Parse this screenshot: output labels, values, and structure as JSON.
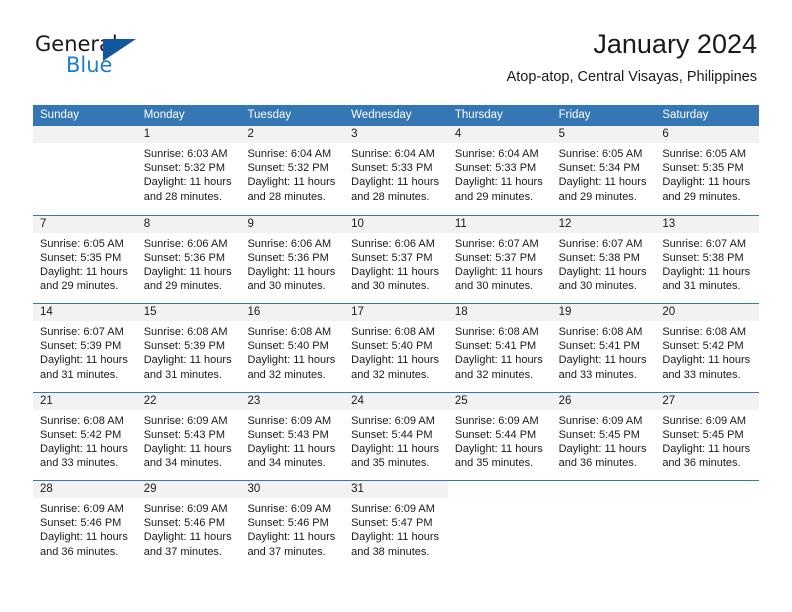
{
  "brand": {
    "word_one": "General",
    "word_two": "Blue",
    "accent_color": "#1f7fc4",
    "triangle_color": "#1257a0"
  },
  "header": {
    "title": "January 2024",
    "location": "Atop-atop, Central Visayas, Philippines"
  },
  "theme": {
    "header_bar_color": "#3576b5",
    "day_band_color": "#f2f2f2",
    "text_color": "#1a1a1a"
  },
  "weekday_headers": [
    "Sunday",
    "Monday",
    "Tuesday",
    "Wednesday",
    "Thursday",
    "Friday",
    "Saturday"
  ],
  "labels": {
    "sunrise_prefix": "Sunrise:",
    "sunset_prefix": "Sunset:",
    "daylight_prefix": "Daylight:"
  },
  "weeks": [
    {
      "days": [
        {
          "num": "",
          "state": "blank",
          "l1": "",
          "l2": "",
          "l3": "",
          "l4": ""
        },
        {
          "num": "1",
          "state": "day",
          "l1": "Sunrise: 6:03 AM",
          "l2": "Sunset: 5:32 PM",
          "l3": "Daylight: 11 hours",
          "l4": "and 28 minutes."
        },
        {
          "num": "2",
          "state": "day",
          "l1": "Sunrise: 6:04 AM",
          "l2": "Sunset: 5:32 PM",
          "l3": "Daylight: 11 hours",
          "l4": "and 28 minutes."
        },
        {
          "num": "3",
          "state": "day",
          "l1": "Sunrise: 6:04 AM",
          "l2": "Sunset: 5:33 PM",
          "l3": "Daylight: 11 hours",
          "l4": "and 28 minutes."
        },
        {
          "num": "4",
          "state": "day",
          "l1": "Sunrise: 6:04 AM",
          "l2": "Sunset: 5:33 PM",
          "l3": "Daylight: 11 hours",
          "l4": "and 29 minutes."
        },
        {
          "num": "5",
          "state": "day",
          "l1": "Sunrise: 6:05 AM",
          "l2": "Sunset: 5:34 PM",
          "l3": "Daylight: 11 hours",
          "l4": "and 29 minutes."
        },
        {
          "num": "6",
          "state": "day",
          "l1": "Sunrise: 6:05 AM",
          "l2": "Sunset: 5:35 PM",
          "l3": "Daylight: 11 hours",
          "l4": "and 29 minutes."
        }
      ]
    },
    {
      "days": [
        {
          "num": "7",
          "state": "day",
          "l1": "Sunrise: 6:05 AM",
          "l2": "Sunset: 5:35 PM",
          "l3": "Daylight: 11 hours",
          "l4": "and 29 minutes."
        },
        {
          "num": "8",
          "state": "day",
          "l1": "Sunrise: 6:06 AM",
          "l2": "Sunset: 5:36 PM",
          "l3": "Daylight: 11 hours",
          "l4": "and 29 minutes."
        },
        {
          "num": "9",
          "state": "day",
          "l1": "Sunrise: 6:06 AM",
          "l2": "Sunset: 5:36 PM",
          "l3": "Daylight: 11 hours",
          "l4": "and 30 minutes."
        },
        {
          "num": "10",
          "state": "day",
          "l1": "Sunrise: 6:06 AM",
          "l2": "Sunset: 5:37 PM",
          "l3": "Daylight: 11 hours",
          "l4": "and 30 minutes."
        },
        {
          "num": "11",
          "state": "day",
          "l1": "Sunrise: 6:07 AM",
          "l2": "Sunset: 5:37 PM",
          "l3": "Daylight: 11 hours",
          "l4": "and 30 minutes."
        },
        {
          "num": "12",
          "state": "day",
          "l1": "Sunrise: 6:07 AM",
          "l2": "Sunset: 5:38 PM",
          "l3": "Daylight: 11 hours",
          "l4": "and 30 minutes."
        },
        {
          "num": "13",
          "state": "day",
          "l1": "Sunrise: 6:07 AM",
          "l2": "Sunset: 5:38 PM",
          "l3": "Daylight: 11 hours",
          "l4": "and 31 minutes."
        }
      ]
    },
    {
      "days": [
        {
          "num": "14",
          "state": "day",
          "l1": "Sunrise: 6:07 AM",
          "l2": "Sunset: 5:39 PM",
          "l3": "Daylight: 11 hours",
          "l4": "and 31 minutes."
        },
        {
          "num": "15",
          "state": "day",
          "l1": "Sunrise: 6:08 AM",
          "l2": "Sunset: 5:39 PM",
          "l3": "Daylight: 11 hours",
          "l4": "and 31 minutes."
        },
        {
          "num": "16",
          "state": "day",
          "l1": "Sunrise: 6:08 AM",
          "l2": "Sunset: 5:40 PM",
          "l3": "Daylight: 11 hours",
          "l4": "and 32 minutes."
        },
        {
          "num": "17",
          "state": "day",
          "l1": "Sunrise: 6:08 AM",
          "l2": "Sunset: 5:40 PM",
          "l3": "Daylight: 11 hours",
          "l4": "and 32 minutes."
        },
        {
          "num": "18",
          "state": "day",
          "l1": "Sunrise: 6:08 AM",
          "l2": "Sunset: 5:41 PM",
          "l3": "Daylight: 11 hours",
          "l4": "and 32 minutes."
        },
        {
          "num": "19",
          "state": "day",
          "l1": "Sunrise: 6:08 AM",
          "l2": "Sunset: 5:41 PM",
          "l3": "Daylight: 11 hours",
          "l4": "and 33 minutes."
        },
        {
          "num": "20",
          "state": "day",
          "l1": "Sunrise: 6:08 AM",
          "l2": "Sunset: 5:42 PM",
          "l3": "Daylight: 11 hours",
          "l4": "and 33 minutes."
        }
      ]
    },
    {
      "days": [
        {
          "num": "21",
          "state": "day",
          "l1": "Sunrise: 6:08 AM",
          "l2": "Sunset: 5:42 PM",
          "l3": "Daylight: 11 hours",
          "l4": "and 33 minutes."
        },
        {
          "num": "22",
          "state": "day",
          "l1": "Sunrise: 6:09 AM",
          "l2": "Sunset: 5:43 PM",
          "l3": "Daylight: 11 hours",
          "l4": "and 34 minutes."
        },
        {
          "num": "23",
          "state": "day",
          "l1": "Sunrise: 6:09 AM",
          "l2": "Sunset: 5:43 PM",
          "l3": "Daylight: 11 hours",
          "l4": "and 34 minutes."
        },
        {
          "num": "24",
          "state": "day",
          "l1": "Sunrise: 6:09 AM",
          "l2": "Sunset: 5:44 PM",
          "l3": "Daylight: 11 hours",
          "l4": "and 35 minutes."
        },
        {
          "num": "25",
          "state": "day",
          "l1": "Sunrise: 6:09 AM",
          "l2": "Sunset: 5:44 PM",
          "l3": "Daylight: 11 hours",
          "l4": "and 35 minutes."
        },
        {
          "num": "26",
          "state": "day",
          "l1": "Sunrise: 6:09 AM",
          "l2": "Sunset: 5:45 PM",
          "l3": "Daylight: 11 hours",
          "l4": "and 36 minutes."
        },
        {
          "num": "27",
          "state": "day",
          "l1": "Sunrise: 6:09 AM",
          "l2": "Sunset: 5:45 PM",
          "l3": "Daylight: 11 hours",
          "l4": "and 36 minutes."
        }
      ]
    },
    {
      "days": [
        {
          "num": "28",
          "state": "day",
          "l1": "Sunrise: 6:09 AM",
          "l2": "Sunset: 5:46 PM",
          "l3": "Daylight: 11 hours",
          "l4": "and 36 minutes."
        },
        {
          "num": "29",
          "state": "day",
          "l1": "Sunrise: 6:09 AM",
          "l2": "Sunset: 5:46 PM",
          "l3": "Daylight: 11 hours",
          "l4": "and 37 minutes."
        },
        {
          "num": "30",
          "state": "day",
          "l1": "Sunrise: 6:09 AM",
          "l2": "Sunset: 5:46 PM",
          "l3": "Daylight: 11 hours",
          "l4": "and 37 minutes."
        },
        {
          "num": "31",
          "state": "day",
          "l1": "Sunrise: 6:09 AM",
          "l2": "Sunset: 5:47 PM",
          "l3": "Daylight: 11 hours",
          "l4": "and 38 minutes."
        },
        {
          "num": "",
          "state": "empty",
          "l1": "",
          "l2": "",
          "l3": "",
          "l4": ""
        },
        {
          "num": "",
          "state": "empty",
          "l1": "",
          "l2": "",
          "l3": "",
          "l4": ""
        },
        {
          "num": "",
          "state": "empty",
          "l1": "",
          "l2": "",
          "l3": "",
          "l4": ""
        }
      ]
    }
  ]
}
